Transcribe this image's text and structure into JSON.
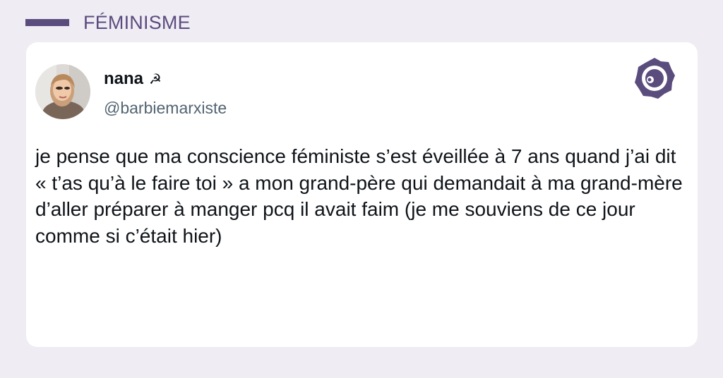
{
  "category": {
    "label": "FÉMINISME",
    "accent_color": "#5b4c7e"
  },
  "tweet": {
    "author": {
      "display_name": "nana",
      "name_emoji": "☭",
      "handle": "@barbiemarxiste",
      "avatar_icon": "profile-photo"
    },
    "text": "je pense que ma conscience féministe s’est éveillée à 7 ans quand j’ai dit « t’as qu’à le faire toi » a mon grand-père qui demandait à ma grand-mère d’aller préparer à manger pcq il avait faim (je me souviens de ce jour comme si c’était hier)",
    "brand_icon": "brand-logo-icon"
  },
  "colors": {
    "background": "#efecf4",
    "card": "#ffffff",
    "text": "#0f1419",
    "handle": "#536471"
  }
}
